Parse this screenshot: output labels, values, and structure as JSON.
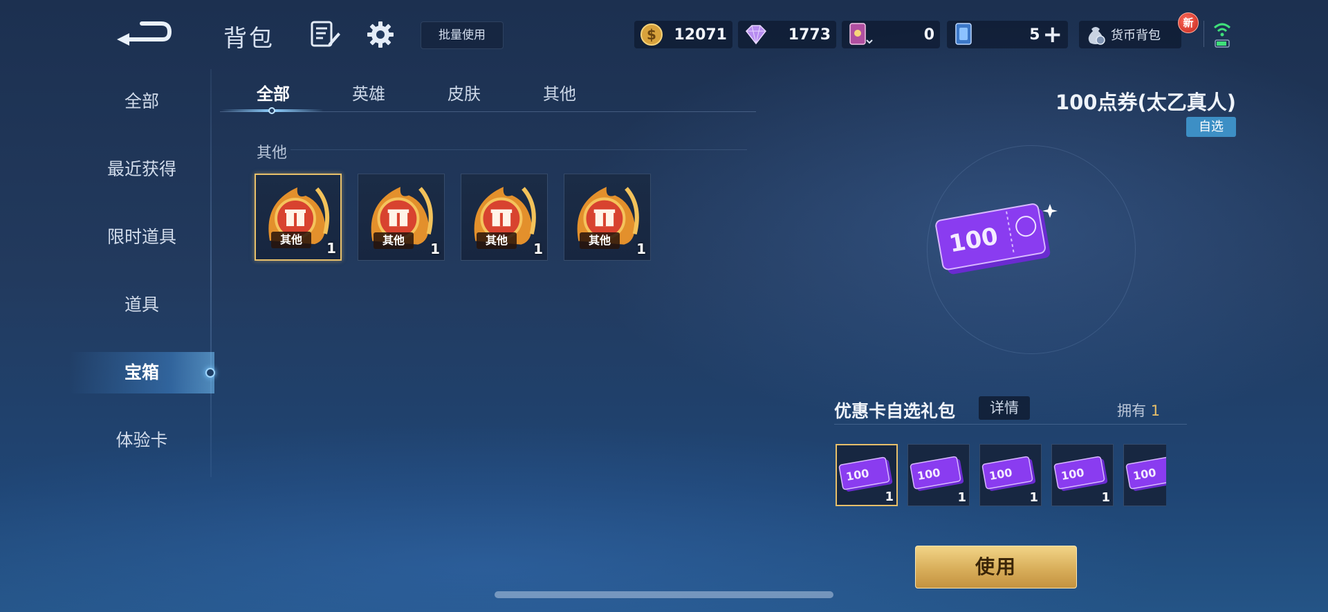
{
  "header": {
    "title": "背包",
    "batch_use_label": "批量使用",
    "currencies": [
      {
        "icon": "gold-coin-icon",
        "value": "12071"
      },
      {
        "icon": "diamond-icon",
        "value": "1773"
      },
      {
        "icon": "purple-card-icon",
        "value": "0"
      },
      {
        "icon": "blue-card-icon",
        "value": "5"
      }
    ],
    "wallet_label": "货币背包",
    "new_badge": "新"
  },
  "sidebar": {
    "items": [
      {
        "label": "全部"
      },
      {
        "label": "最近获得"
      },
      {
        "label": "限时道具"
      },
      {
        "label": "道具"
      },
      {
        "label": "宝箱",
        "active": true
      },
      {
        "label": "体验卡"
      }
    ]
  },
  "tabs": [
    {
      "label": "全部",
      "active": true
    },
    {
      "label": "英雄"
    },
    {
      "label": "皮肤"
    },
    {
      "label": "其他"
    }
  ],
  "section": {
    "label": "其他",
    "items": [
      {
        "tag": "其他",
        "count": "1",
        "selected": true
      },
      {
        "tag": "其他",
        "count": "1"
      },
      {
        "tag": "其他",
        "count": "1"
      },
      {
        "tag": "其他",
        "count": "1"
      }
    ]
  },
  "detail": {
    "title": "100点券(太乙真人)",
    "badge": "自选",
    "preview_value": "100",
    "pack": {
      "title": "优惠卡自选礼包",
      "detail_label": "详情",
      "own_label": "拥有",
      "own_count": "1",
      "items": [
        {
          "value": "100",
          "count": "1",
          "selected": true
        },
        {
          "value": "100",
          "count": "1"
        },
        {
          "value": "100",
          "count": "1"
        },
        {
          "value": "100",
          "count": "1"
        },
        {
          "value": "100",
          "count": ""
        }
      ]
    },
    "use_label": "使用"
  },
  "colors": {
    "accent_gold": "#e8c06a",
    "badge_blue": "#3d8fc5",
    "voucher_purple": "#8a3cf0"
  }
}
